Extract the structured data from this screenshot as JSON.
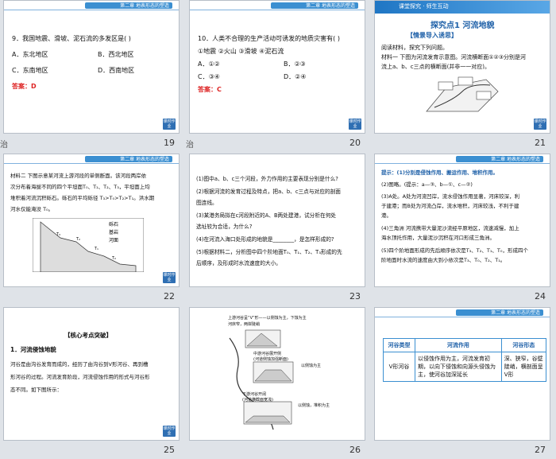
{
  "header_text": "第二章  地表形态的塑造",
  "side_button": "课时作业",
  "slides": [
    {
      "label": "",
      "num": "19"
    },
    {
      "label": "",
      "num": "20"
    },
    {
      "label": "",
      "num": "21"
    },
    {
      "label": "",
      "num": "22"
    },
    {
      "label": "",
      "num": "23"
    },
    {
      "label": "",
      "num": "24"
    },
    {
      "label": "",
      "num": "25"
    },
    {
      "label": "",
      "num": "26"
    },
    {
      "label": "",
      "num": "27"
    }
  ],
  "strip_left": {
    "s1": "治",
    "s2": "治"
  },
  "s19": {
    "q": "9．我国地震、滑坡、泥石流的多发区是(      )",
    "a": "A．东北地区",
    "b": "B．西北地区",
    "c": "C．东南地区",
    "d": "D．西南地区",
    "ans_label": "答案：",
    "ans": "D"
  },
  "s20": {
    "q": "10．人类不合理的生产活动可诱发的地质灾害有(      )",
    "opts": "①地震  ②火山  ③滑坡  ④泥石流",
    "a": "A．①②",
    "b": "B．②③",
    "c": "C．③④",
    "d": "D．②④",
    "ans_label": "答案：",
    "ans": "C"
  },
  "s21": {
    "banner": "课堂探究 · 师生互动",
    "title": "探究点1  河流地貌",
    "sub": "【情景导入诱思】",
    "l1": "阅读材料，探究下列问题。",
    "l2": "材料一  下图为河流发育示意图。河流横断面①②③分别是河",
    "l3": "流上a、b、c三点的横断面(并非一一对应)。"
  },
  "s22": {
    "l1": "材料二  下图示意某河流上游河段的单侧断面。该河段两岸依",
    "l2": "次分布着海拔不同的四个平坦面T₀、T₁、T₂、T₃，平坦面上均",
    "l3": "堆积着河流沉积砾石。砾石的平均砾径 T₃>T₀>T₂>T₁。洪水期",
    "l4": "河水仅能淹没 T₀。",
    "leg1": "砾石",
    "leg2": "基岩",
    "leg3": "河面"
  },
  "s23": {
    "l1": "(1)图中a、b、c三个河段，外力作用的主要表现分别是什么?",
    "l2": "(2)根据河流的发育过程及特点，把a、b、c三点与对应的剖面",
    "l3": "图连线。",
    "l4": "(3)某港务局拟在c河段附近的A、B两处建港，试分析在何处",
    "l5": "选址较为合适，为什么?",
    "l6": "(4)在河流入海口处形成的地貌是________，是怎样形成的?",
    "l7": "(5)根据材料二，分析图中四个阶地面T₀、T₁、T₂、T₃形成的先",
    "l8": "后顺序，及形成时水流速度的大小。"
  },
  "s24": {
    "l1": "提示：(1)分别是侵蚀作用、搬运作用、堆积作用。",
    "l2": "(2)图略。(提示：a—③、b—①、c—②)",
    "l3": "(3)A处。A处为河流凹岸，流水侵蚀作用显著，河床较深，利",
    "l4": "于建港；而B处为河流凸岸，流水堆积，河床较浅，不利于建",
    "l5": "港。",
    "l6": "(4)三角洲  河流携带大量泥沙流经平原地区，流速减慢，加上",
    "l7": "海水顶托作用，大量泥沙沉积在河口形成三角洲。",
    "l8": "(5)四个阶地面形成的先后顺序依次是T₃、T₂、T₁、T₀，形成四个",
    "l9": "阶地面时水流的速度由大到小依次是T₃、T₀、T₂、T₁。"
  },
  "s25": {
    "title": "【核心考点突破】",
    "h": "1．河流侵蚀地貌",
    "l1": "河谷是由沟谷发育而成的，经历了由沟谷到V形河谷、再到槽",
    "l2": "形河谷的过程。河流发育阶段，河流侵蚀作用的形式与河谷形",
    "l3": "态不同。如下图所示："
  },
  "s26": {
    "t1": "上游河谷呈“V”形——以侧蚀为主，下蚀为主",
    "t2": "河床窄，两岸陡峭",
    "t3": "中游河谷展开侧",
    "t4": "(河道侧蚀加强断面)",
    "t5": "以侧蚀为主",
    "t6": "下游河谷开阔",
    "t7": "(河道横截面宽浅)",
    "t8": "以侧蚀，堆积为主"
  },
  "s27": {
    "headers": [
      "河谷类型",
      "河流作用",
      "河谷形态"
    ],
    "row_type": "V形河谷",
    "row_action": "以侵蚀作用为主，河流发育初期，以向下侵蚀和向源头侵蚀为主，使河谷加深延长",
    "row_shape": "深、狭窄，谷壁陡峭，横剖面呈V形"
  }
}
